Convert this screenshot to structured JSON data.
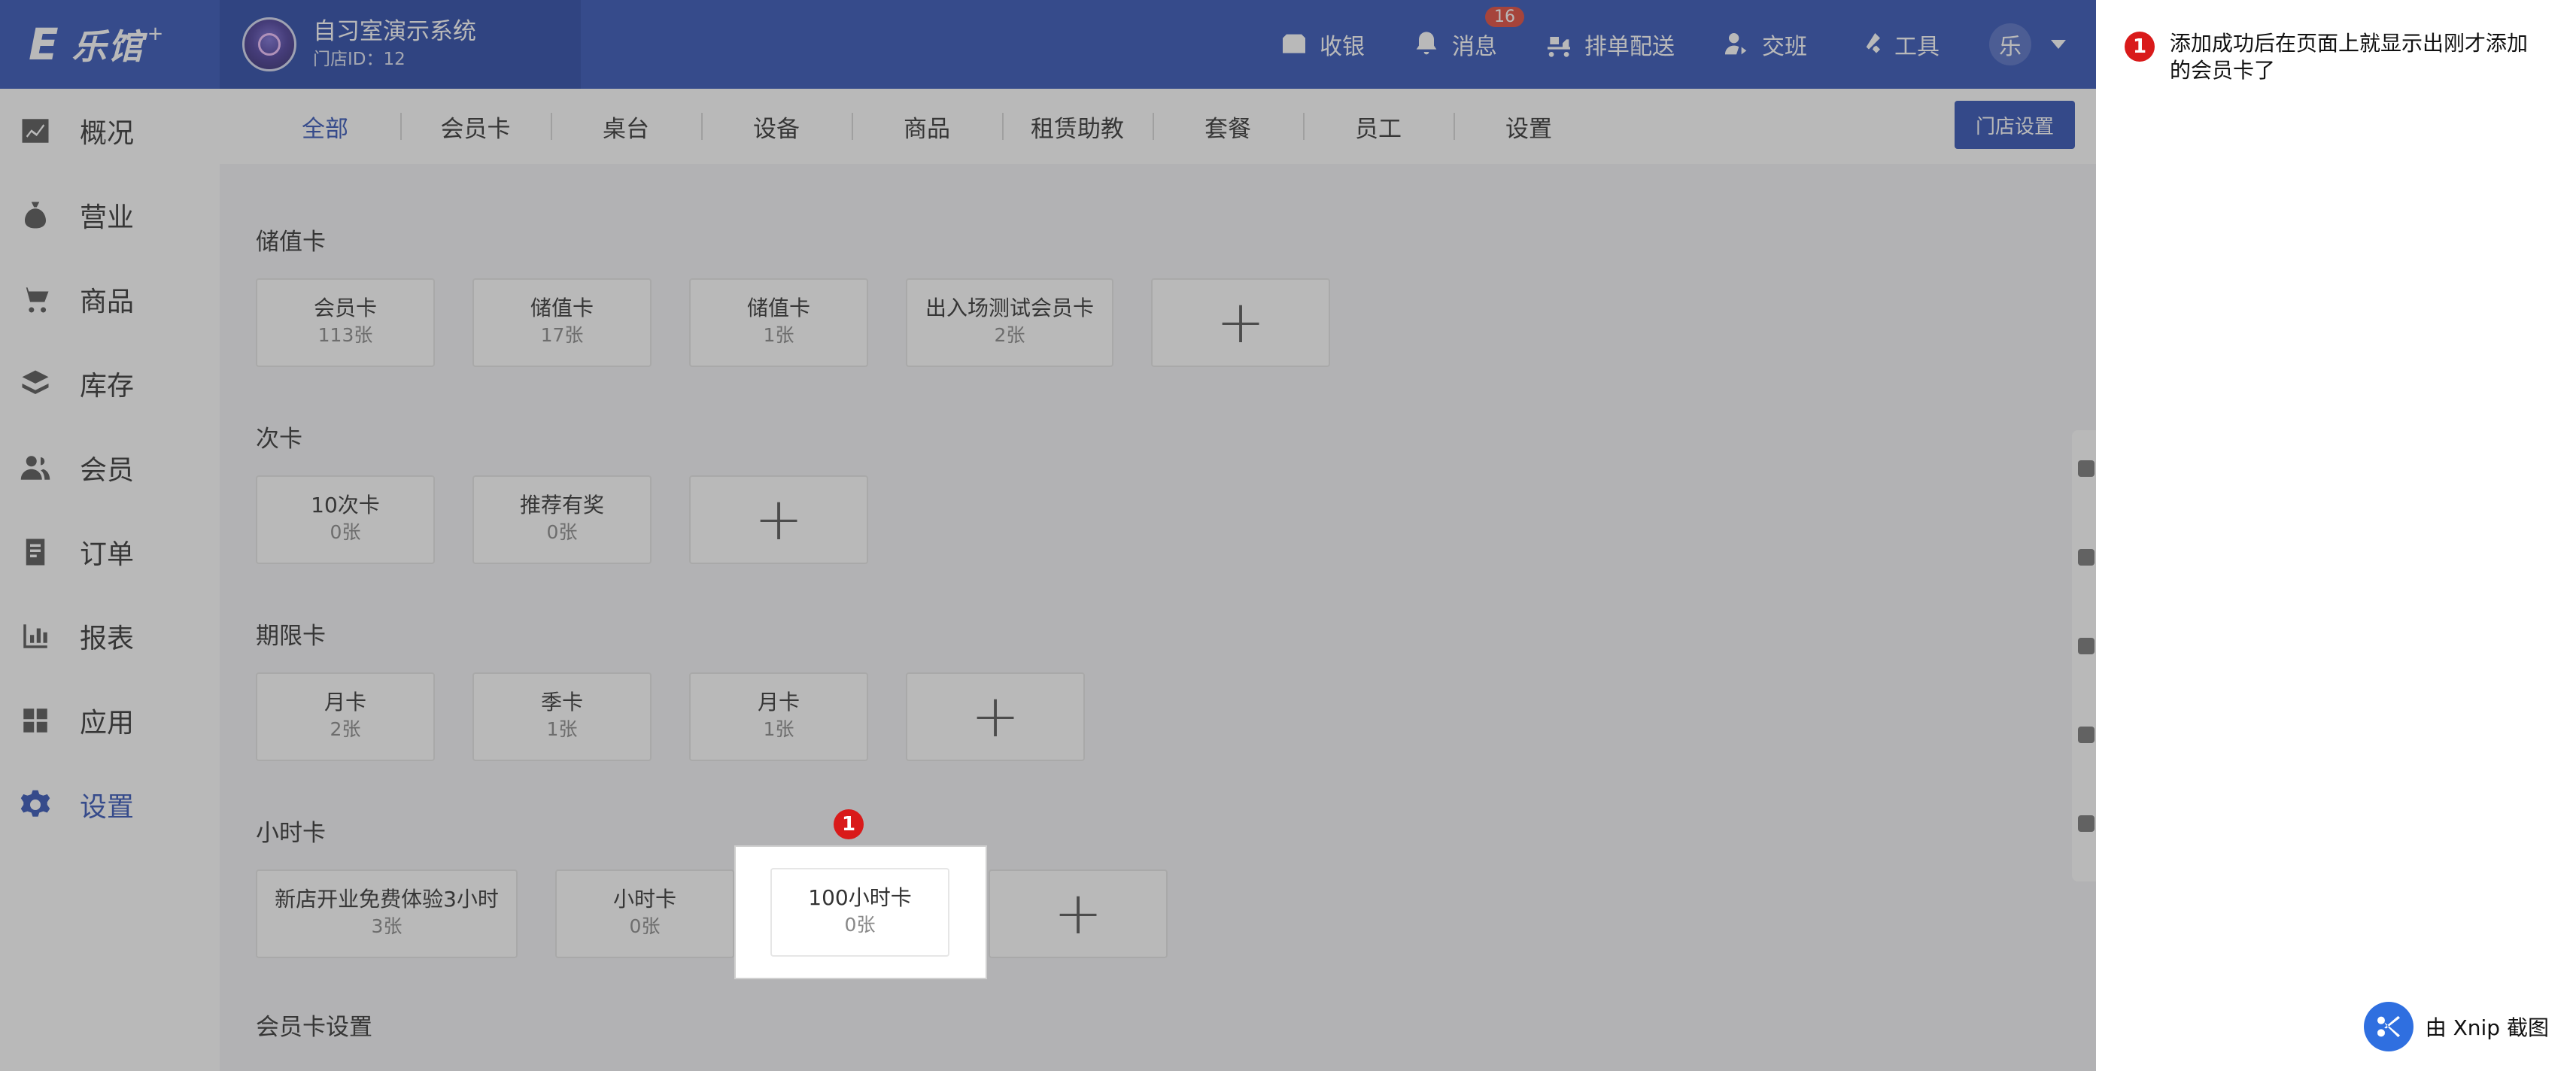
{
  "header": {
    "logo_mark": "E",
    "brand": "乐馆",
    "brand_plus": "+",
    "store_name": "自习室演示系统",
    "store_id": "门店ID：12",
    "tools": [
      {
        "label": "收银",
        "icon": "cashier-icon"
      },
      {
        "label": "消息",
        "icon": "bell-icon",
        "badge": "16"
      },
      {
        "label": "排单配送",
        "icon": "delivery-icon"
      },
      {
        "label": "交班",
        "icon": "handover-icon"
      },
      {
        "label": "工具",
        "icon": "tools-icon"
      }
    ],
    "user_avatar": "乐"
  },
  "sidebar": {
    "items": [
      {
        "label": "概况",
        "icon": "chart-icon"
      },
      {
        "label": "营业",
        "icon": "money-bag-icon"
      },
      {
        "label": "商品",
        "icon": "cart-icon"
      },
      {
        "label": "库存",
        "icon": "layers-icon"
      },
      {
        "label": "会员",
        "icon": "users-icon"
      },
      {
        "label": "订单",
        "icon": "order-icon"
      },
      {
        "label": "报表",
        "icon": "bar-chart-icon"
      },
      {
        "label": "应用",
        "icon": "apps-icon"
      },
      {
        "label": "设置",
        "icon": "gear-icon",
        "active": true
      }
    ]
  },
  "tabs": [
    "全部",
    "会员卡",
    "桌台",
    "设备",
    "商品",
    "租赁助教",
    "套餐",
    "员工",
    "设置"
  ],
  "store_settings_label": "门店设置",
  "sections": [
    {
      "title": "储值卡",
      "cards": [
        {
          "name": "会员卡",
          "count": "113张"
        },
        {
          "name": "储值卡",
          "count": "17张"
        },
        {
          "name": "储值卡",
          "count": "1张"
        },
        {
          "name": "出入场测试会员卡",
          "count": "2张"
        }
      ]
    },
    {
      "title": "次卡",
      "cards": [
        {
          "name": "10次卡",
          "count": "0张"
        },
        {
          "name": "推荐有奖",
          "count": "0张"
        }
      ]
    },
    {
      "title": "期限卡",
      "cards": [
        {
          "name": "月卡",
          "count": "2张"
        },
        {
          "name": "季卡",
          "count": "1张"
        },
        {
          "name": "月卡",
          "count": "1张"
        }
      ]
    },
    {
      "title": "小时卡",
      "cards": [
        {
          "name": "新店开业免费体验3小时",
          "count": "3张"
        },
        {
          "name": "小时卡",
          "count": "0张"
        },
        {
          "name": "100小时卡",
          "count": "0张"
        }
      ]
    },
    {
      "title": "会员卡设置",
      "cards": []
    }
  ],
  "add_symbol": "+",
  "annotation": {
    "number": "1",
    "text": "添加成功后在页面上就显示出刚才添加的会员卡了"
  },
  "credit": "由 Xnip 截图",
  "colors": {
    "primary": "#3354b8",
    "marker": "#d91a1a"
  }
}
